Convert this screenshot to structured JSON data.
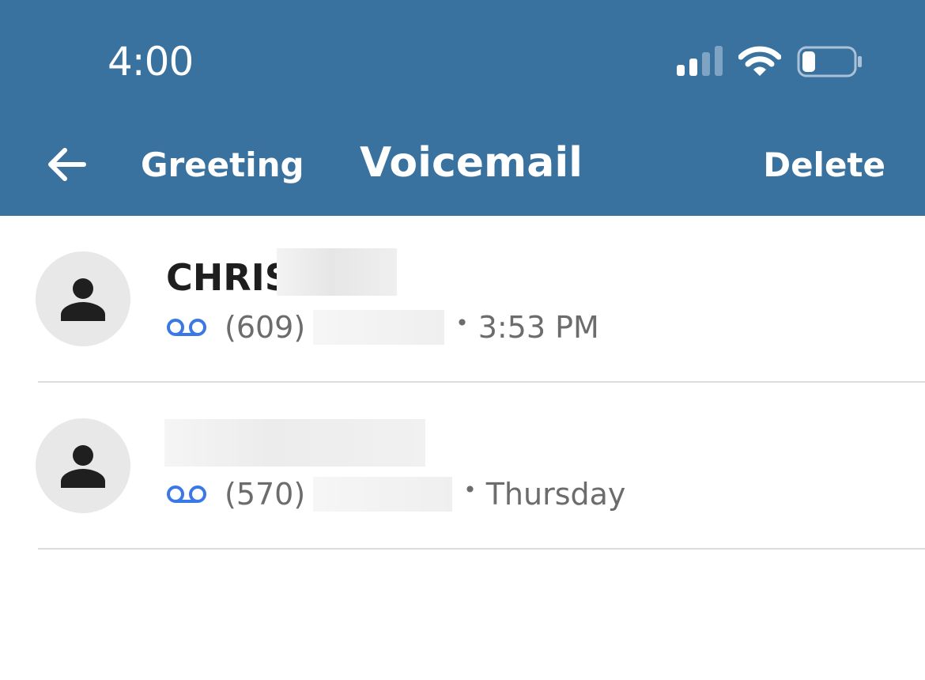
{
  "status_bar": {
    "time": "4:00",
    "icons": [
      "cellular-signal-icon",
      "wifi-icon",
      "battery-icon"
    ]
  },
  "nav": {
    "back_icon": "arrow-left-icon",
    "greeting_label": "Greeting",
    "title": "Voicemail",
    "delete_label": "Delete"
  },
  "voicemails": [
    {
      "name": "CHRIS",
      "number_prefix": "(609)",
      "time": "3:53 PM",
      "icon": "voicemail-icon",
      "avatar_icon": "person-icon"
    },
    {
      "name": "",
      "number_prefix": "(570)",
      "time": "Thursday",
      "icon": "voicemail-icon",
      "avatar_icon": "person-icon"
    }
  ],
  "colors": {
    "header_bg": "#3a729f",
    "voicemail_icon": "#3b78e7",
    "secondary_text": "#6c6c6c",
    "avatar_bg": "#e8e8e8"
  }
}
